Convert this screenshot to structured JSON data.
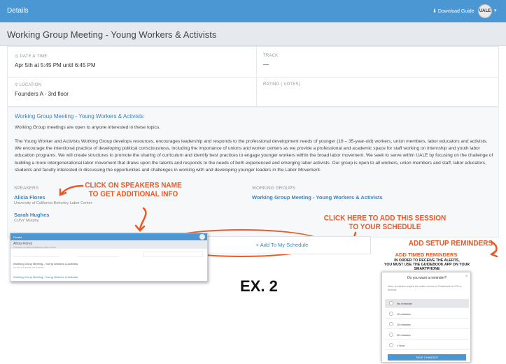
{
  "topbar": {
    "title": "Details",
    "download_label": "Download Guide",
    "avatar_text": "UALE"
  },
  "page": {
    "title": "Working Group Meeting - Young Workers & Activists"
  },
  "info": {
    "date_label": "DATE & TIME",
    "date_value": "Apr 5th at 5:45 PM until 6:45 PM",
    "track_label": "TRACK",
    "track_value": "—",
    "location_label": "LOCATION",
    "location_value": "Founders A - 3rd floor",
    "rating_label": "RATING ( VOTES)"
  },
  "description": {
    "heading": "Working Group Meeting - Young Workers & Activists",
    "intro": "Working Group meetings are open to anyone interested in these topics.",
    "body": "The Young Worker and Activists Working Group develops resources, encourages leadership and responds to the professional development needs of younger (18 – 35-year-old) workers, union members, labor educators and activists. We encourage the intentional practice of developing political consciousness, including the importance of unions and worker centers as we provide a professional and academic space for staff working on internship and youth labor education programs. We will create structures to promote the sharing of curriculum and identify best practices to engage younger workers within the broad labor movement. We seek to serve within UALE by focusing on the challenge of building a more intergenerational labor movement that draws upon the talents and responds to the needs of both experienced and emerging labor activists. Our group is open to all workers, union members and staff, labor educators, students and faculty interested in discussing the opportunities and challenges in working with and developing younger leaders in the Labor Movement."
  },
  "speakers": {
    "label": "SPEAKERS",
    "items": [
      {
        "name": "Alicia Flores",
        "org": "University of California Berkeley Labor Center"
      },
      {
        "name": "Sarah Hughes",
        "org": "CUNY Murphy"
      }
    ]
  },
  "working_groups": {
    "label": "WORKING GROUPS",
    "item": "Working Group Meeting - Young Workers & Activists"
  },
  "schedule_button": "+ Add To My Schedule",
  "annotations": {
    "speakers": "CLICK ON SPEAKERS NAME\nTO GET ADDITIONAL INFO",
    "schedule": "CLICK HERE TO ADD THIS SESSION\nTO YOUR SCHEDULE",
    "reminders": "ADD SETUP REMINDERS",
    "timed_title": "ADD TIMED REMINDERS",
    "timed_sub": "IN ORDER TO RECEIVE THE ALERTS,\nYOU MUST USE THE GUIDEBOOK APP ON YOUR SMARTPHONE",
    "example": "EX. 2"
  },
  "mini_preview": {
    "bar_title": "Details",
    "name": "Alicia Flores",
    "org": "University of California Berkeley Labor Center",
    "session": "Working Group Meeting - Young Workers & Activists",
    "session_time": "Apr 5th at 5:45 PM until 6:45 PM",
    "group_session": "Working Group Meeting - Young Workers & Activists"
  },
  "modal": {
    "title": "Do you want a reminder?",
    "close": "×",
    "note": "Note: reminders require the native version of Guidebook for iOS or Android",
    "options": [
      "No reminder",
      "10 minutes",
      "15 minutes",
      "30 minutes",
      "1 hour"
    ],
    "save_label": "SAVE CHANGES"
  },
  "colors": {
    "accent": "#4a97d4",
    "annotation": "#e85a2a"
  }
}
